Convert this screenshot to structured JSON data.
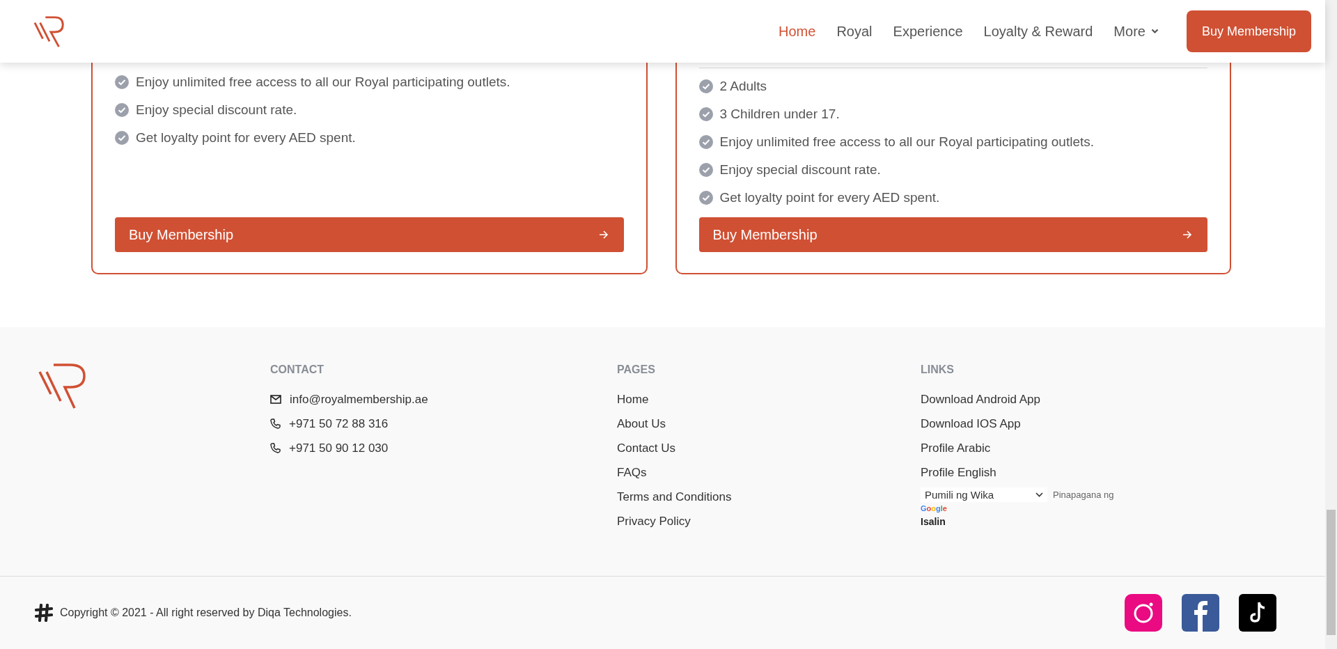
{
  "header": {
    "nav": [
      {
        "label": "Home",
        "selected": true,
        "kind": "link"
      },
      {
        "label": "Royal",
        "selected": false,
        "kind": "link"
      },
      {
        "label": "Experience",
        "selected": false,
        "kind": "link"
      },
      {
        "label": "Loyalty & Reward",
        "selected": false,
        "kind": "link"
      },
      {
        "label": "More",
        "selected": false,
        "kind": "dropdown"
      }
    ],
    "cta": "Buy Membership"
  },
  "plans": [
    {
      "divider": false,
      "features": [
        "Enjoy unlimited free access to all our Royal participating outlets.",
        "Enjoy special discount rate.",
        "Get loyalty point for every AED spent."
      ],
      "button": "Buy Membership"
    },
    {
      "divider": true,
      "features": [
        "2 Adults",
        "3 Children under 17.",
        "Enjoy unlimited free access to all our Royal participating outlets.",
        "Enjoy special discount rate.",
        "Get loyalty point for every AED spent."
      ],
      "button": "Buy Membership"
    }
  ],
  "footer": {
    "contact": {
      "heading": "CONTACT",
      "items": [
        {
          "kind": "email",
          "text": "info@royalmembership.ae"
        },
        {
          "kind": "phone",
          "text": "+971 50 72 88 316"
        },
        {
          "kind": "phone",
          "text": "+971 50 90 12 030"
        }
      ]
    },
    "pages": {
      "heading": "PAGES",
      "items": [
        "Home",
        "About Us",
        "Contact Us",
        "FAQs",
        "Terms and Conditions",
        "Privacy Policy"
      ]
    },
    "links": {
      "heading": "LINKS",
      "items": [
        "Download Android App",
        "Download IOS App",
        "Profile Arabic",
        "Profile English"
      ]
    },
    "translate": {
      "select": "Pumili ng Wika",
      "powered_by": "Pinapagana ng",
      "brand": "Google",
      "action": "Isalin"
    },
    "copyright": "Copyright © 2021 - All right reserved by Diqa Technologies."
  }
}
